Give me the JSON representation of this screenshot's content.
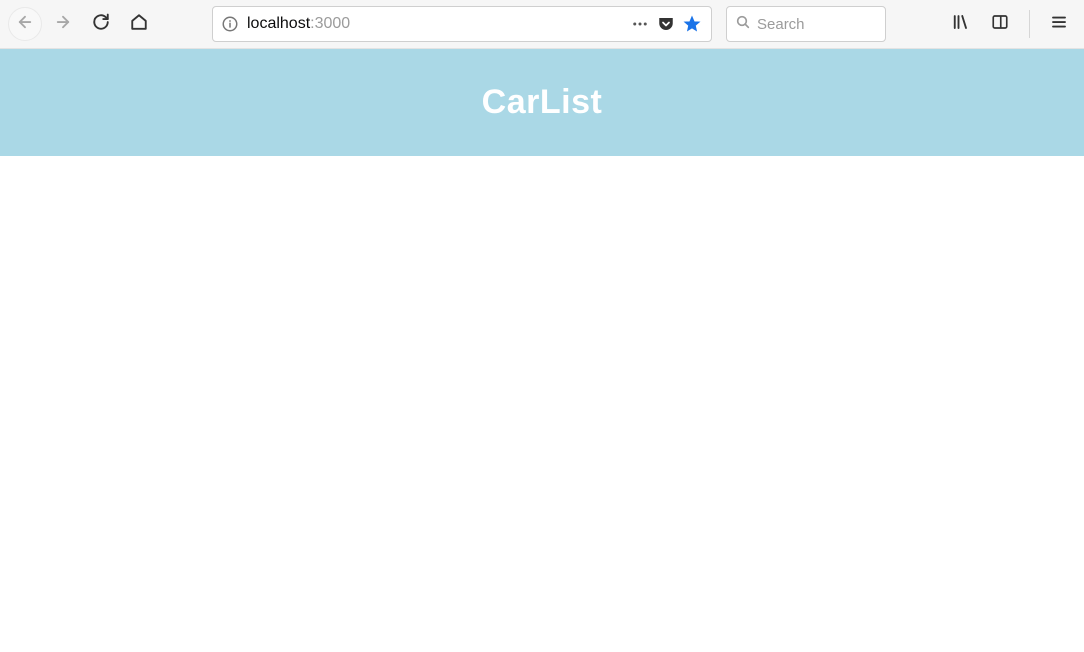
{
  "browser": {
    "url_host": "localhost",
    "url_port": ":3000",
    "search_placeholder": "Search"
  },
  "page": {
    "title": "CarList"
  }
}
